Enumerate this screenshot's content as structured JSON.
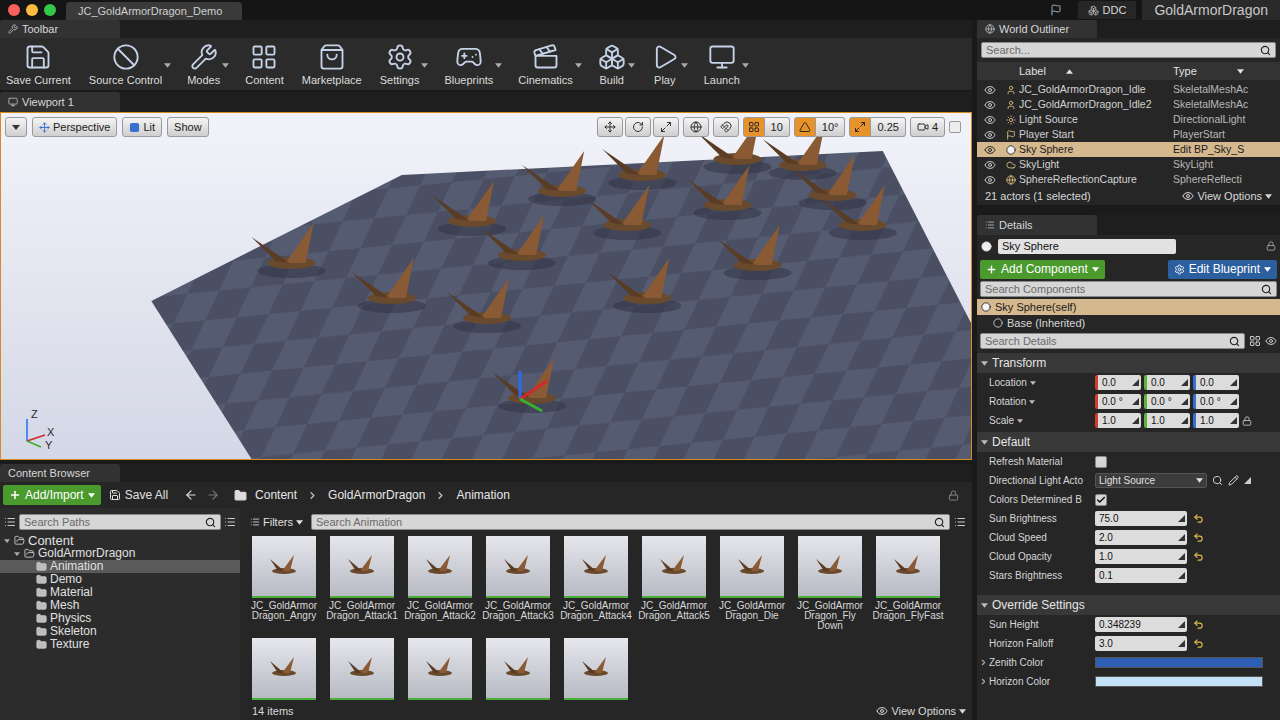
{
  "window": {
    "tab": "JC_GoldArmorDragon_Demo",
    "ddc": "DDC",
    "project": "GoldArmorDragon"
  },
  "toolbar": {
    "tab": "Toolbar",
    "buttons": [
      {
        "label": "Save Current",
        "dropdown": false
      },
      {
        "label": "Source Control",
        "dropdown": true
      },
      {
        "label": "Modes",
        "dropdown": true
      },
      {
        "label": "Content",
        "dropdown": false
      },
      {
        "label": "Marketplace",
        "dropdown": false
      },
      {
        "label": "Settings",
        "dropdown": true
      },
      {
        "label": "Blueprints",
        "dropdown": true
      },
      {
        "label": "Cinematics",
        "dropdown": true
      },
      {
        "label": "Build",
        "dropdown": true
      },
      {
        "label": "Play",
        "dropdown": true
      },
      {
        "label": "Launch",
        "dropdown": true
      }
    ]
  },
  "viewport": {
    "tab": "Viewport 1",
    "view": "Perspective",
    "mode": "Lit",
    "show": "Show",
    "snaps": [
      {
        "value": "10",
        "on": true
      },
      {
        "value": "10°",
        "on": true
      },
      {
        "value": "0.25",
        "on": true
      }
    ],
    "camera_speed": "4",
    "axes": [
      "Z",
      "X",
      "Y"
    ]
  },
  "content_browser": {
    "tab": "Content Browser",
    "add_import": "Add/Import",
    "save_all": "Save All",
    "path": [
      "Content",
      "GoldArmorDragon",
      "Animation"
    ],
    "search_paths": "Search Paths",
    "tree": [
      {
        "label": "Content",
        "depth": 0,
        "expanded": true,
        "selected": false
      },
      {
        "label": "GoldArmorDragon",
        "depth": 1,
        "expanded": true,
        "selected": false
      },
      {
        "label": "Animation",
        "depth": 2,
        "expanded": false,
        "selected": true
      },
      {
        "label": "Demo",
        "depth": 2,
        "expanded": false,
        "selected": false
      },
      {
        "label": "Material",
        "depth": 2,
        "expanded": false,
        "selected": false
      },
      {
        "label": "Mesh",
        "depth": 2,
        "expanded": false,
        "selected": false
      },
      {
        "label": "Physics",
        "depth": 2,
        "expanded": false,
        "selected": false
      },
      {
        "label": "Skeleton",
        "depth": 2,
        "expanded": false,
        "selected": false
      },
      {
        "label": "Texture",
        "depth": 2,
        "expanded": false,
        "selected": false
      }
    ],
    "filters": "Filters",
    "search": "Search Animation",
    "assets": [
      {
        "lines": [
          "JC_GoldArmor",
          "Dragon_Angry"
        ]
      },
      {
        "lines": [
          "JC_GoldArmor",
          "Dragon_Attack1"
        ]
      },
      {
        "lines": [
          "JC_GoldArmor",
          "Dragon_Attack2"
        ]
      },
      {
        "lines": [
          "JC_GoldArmor",
          "Dragon_Attack3"
        ]
      },
      {
        "lines": [
          "JC_GoldArmor",
          "Dragon_Attack4"
        ]
      },
      {
        "lines": [
          "JC_GoldArmor",
          "Dragon_Attack5"
        ]
      },
      {
        "lines": [
          "JC_GoldArmor",
          "Dragon_Die"
        ]
      },
      {
        "lines": [
          "JC_GoldArmor",
          "Dragon_Fly",
          "Down"
        ]
      },
      {
        "lines": [
          "JC_GoldArmor",
          "Dragon_FlyFast"
        ]
      },
      {
        "lines": []
      },
      {
        "lines": []
      },
      {
        "lines": []
      },
      {
        "lines": []
      },
      {
        "lines": []
      }
    ],
    "count": "14 items",
    "view_options": "View Options"
  },
  "outliner": {
    "tab": "World Outliner",
    "search": "Search...",
    "columns": [
      "Label",
      "Type"
    ],
    "rows": [
      {
        "label": "JC_GoldArmorDragon_Idle",
        "type": "SkeletalMeshAc",
        "kind": "mesh",
        "visible": true,
        "selected": false
      },
      {
        "label": "JC_GoldArmorDragon_Idle2",
        "type": "SkeletalMeshAc",
        "kind": "mesh",
        "visible": true,
        "selected": false
      },
      {
        "label": "Light Source",
        "type": "DirectionalLight",
        "kind": "light",
        "visible": true,
        "selected": false
      },
      {
        "label": "Player Start",
        "type": "PlayerStart",
        "kind": "start",
        "visible": true,
        "selected": false
      },
      {
        "label": "Sky Sphere",
        "type": "Edit BP_Sky_S",
        "kind": "sky",
        "visible": true,
        "selected": true
      },
      {
        "label": "SkyLight",
        "type": "SkyLight",
        "kind": "skylight",
        "visible": true,
        "selected": false
      },
      {
        "label": "SphereReflectionCapture",
        "type": "SphereReflecti",
        "kind": "capture",
        "visible": true,
        "selected": false
      }
    ],
    "summary": "21 actors (1 selected)",
    "view_options": "View Options"
  },
  "details": {
    "tab": "Details",
    "name": "Sky Sphere",
    "add_component": "Add Component",
    "edit_blueprint": "Edit Blueprint",
    "search_components": "Search Components",
    "components": [
      {
        "label": "Sky Sphere(self)",
        "selected": true
      },
      {
        "label": "Base (Inherited)",
        "selected": false
      }
    ],
    "search_details": "Search Details",
    "sections": [
      {
        "title": "Transform",
        "expanded": true,
        "rows": [
          {
            "kind": "vector",
            "label": "Location",
            "values": [
              "0.0",
              "0.0",
              "0.0"
            ],
            "lock": false
          },
          {
            "kind": "vector",
            "label": "Rotation",
            "values": [
              "0.0 °",
              "0.0 °",
              "0.0 °"
            ],
            "lock": false
          },
          {
            "kind": "vector",
            "label": "Scale",
            "values": [
              "1.0",
              "1.0",
              "1.0"
            ],
            "lock": true
          }
        ]
      },
      {
        "title": "Default",
        "expanded": true,
        "rows": [
          {
            "kind": "checkbox",
            "label": "Refresh Material",
            "checked": false
          },
          {
            "kind": "dropdown",
            "label": "Directional Light Acto",
            "value": "Light Source"
          },
          {
            "kind": "checkbox",
            "label": "Colors Determined B",
            "checked": true
          },
          {
            "kind": "number",
            "label": "Sun Brightness",
            "value": "75.0",
            "modified": true
          },
          {
            "kind": "number",
            "label": "Cloud Speed",
            "value": "2.0",
            "modified": true
          },
          {
            "kind": "number",
            "label": "Cloud Opacity",
            "value": "1.0",
            "modified": true
          },
          {
            "kind": "number",
            "label": "Stars Brightness",
            "value": "0.1",
            "modified": false
          }
        ]
      },
      {
        "title": "Override Settings",
        "expanded": true,
        "rows": [
          {
            "kind": "number",
            "label": "Sun Height",
            "value": "0.348239",
            "modified": true
          },
          {
            "kind": "number",
            "label": "Horizon Falloff",
            "value": "3.0",
            "modified": true
          },
          {
            "kind": "color",
            "label": "Zenith Color",
            "color": "#2f5fb4",
            "expanded": false
          },
          {
            "kind": "color",
            "label": "Horizon Color",
            "color": "#c3e2f7",
            "expanded": false
          }
        ]
      }
    ]
  }
}
